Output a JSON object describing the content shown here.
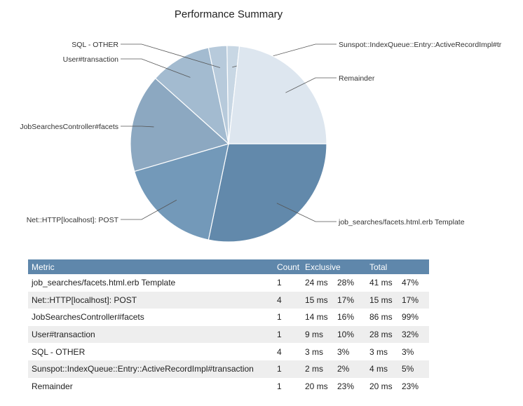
{
  "chart_data": {
    "type": "pie",
    "title": "Performance Summary",
    "slices": [
      {
        "label": "job_searches/facets.html.erb Template",
        "value": 28,
        "color": "#6289ab"
      },
      {
        "label": "Net::HTTP[localhost]: POST",
        "value": 17,
        "color": "#7399b9"
      },
      {
        "label": "JobSearchesController#facets",
        "value": 16,
        "color": "#8ca8c1"
      },
      {
        "label": "User#transaction",
        "value": 10,
        "color": "#a3bbd0"
      },
      {
        "label": "SQL - OTHER",
        "value": 3,
        "color": "#b7cadb"
      },
      {
        "label": "Sunspot::IndexQueue::Entry::ActiveRecordImpl#tr",
        "value": 2,
        "color": "#c8d7e4"
      },
      {
        "label": "Remainder",
        "value": 23,
        "color": "#dde6ef"
      }
    ]
  },
  "table": {
    "headers": {
      "metric": "Metric",
      "count": "Count",
      "exclusive": "Exclusive",
      "total": "Total"
    },
    "rows": [
      {
        "metric": "job_searches/facets.html.erb Template",
        "count": "1",
        "exc_ms": "24 ms",
        "exc_pct": "28%",
        "tot_ms": "41 ms",
        "tot_pct": "47%"
      },
      {
        "metric": "Net::HTTP[localhost]: POST",
        "count": "4",
        "exc_ms": "15 ms",
        "exc_pct": "17%",
        "tot_ms": "15 ms",
        "tot_pct": "17%"
      },
      {
        "metric": "JobSearchesController#facets",
        "count": "1",
        "exc_ms": "14 ms",
        "exc_pct": "16%",
        "tot_ms": "86 ms",
        "tot_pct": "99%"
      },
      {
        "metric": "User#transaction",
        "count": "1",
        "exc_ms": "9 ms",
        "exc_pct": "10%",
        "tot_ms": "28 ms",
        "tot_pct": "32%"
      },
      {
        "metric": "SQL - OTHER",
        "count": "4",
        "exc_ms": "3 ms",
        "exc_pct": "3%",
        "tot_ms": "3 ms",
        "tot_pct": "3%"
      },
      {
        "metric": "Sunspot::IndexQueue::Entry::ActiveRecordImpl#transaction",
        "count": "1",
        "exc_ms": "2 ms",
        "exc_pct": "2%",
        "tot_ms": "4 ms",
        "tot_pct": "5%"
      },
      {
        "metric": "Remainder",
        "count": "1",
        "exc_ms": "20 ms",
        "exc_pct": "23%",
        "tot_ms": "20 ms",
        "tot_pct": "23%"
      }
    ]
  }
}
